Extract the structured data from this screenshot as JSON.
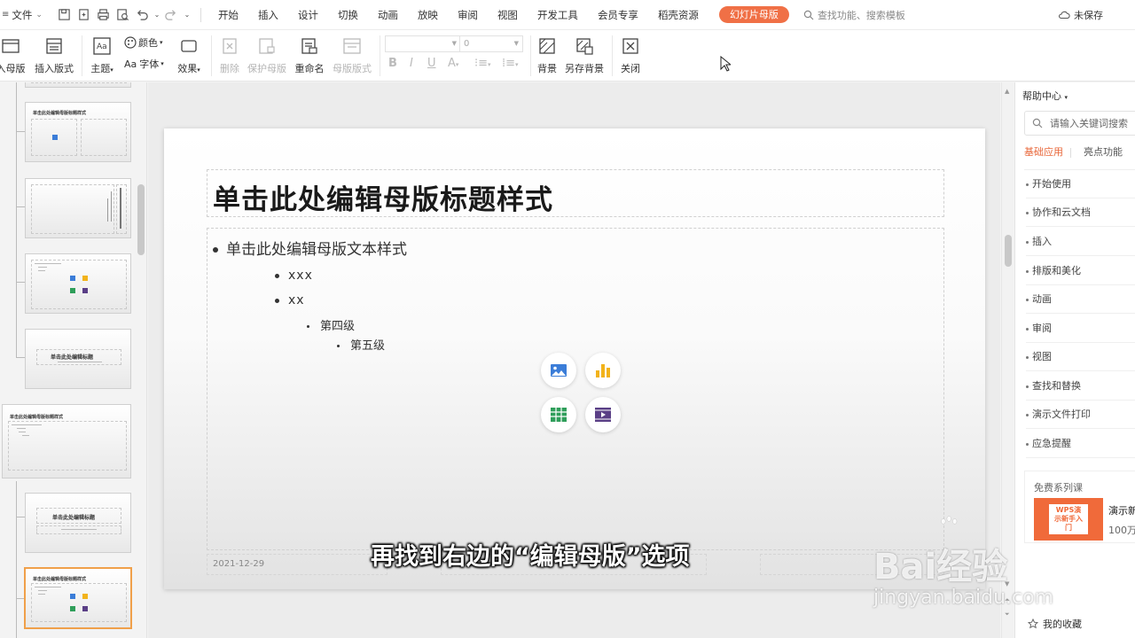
{
  "menubar": {
    "file_label": "文件",
    "tabs": [
      "开始",
      "插入",
      "设计",
      "切换",
      "动画",
      "放映",
      "审阅",
      "视图",
      "开发工具",
      "会员专享",
      "稻壳资源"
    ],
    "active_tab": "幻灯片母版",
    "search_label": "查找功能、搜索模板",
    "save_status": "未保存"
  },
  "ribbon": {
    "insert_master": "入母版",
    "insert_layout": "插入版式",
    "theme": "主题",
    "color": "颜色",
    "font": "字体",
    "font_prefix": "Aa",
    "effect": "效果",
    "delete": "删除",
    "protect_master": "保护母版",
    "rename": "重命名",
    "master_layout": "母版版式",
    "font_size_value": "0",
    "background": "背景",
    "save_background": "另存背景",
    "close": "关闭"
  },
  "thumbs": {
    "title_small": "单击此处编辑母版标题样式",
    "title_center": "单击此处编辑标题"
  },
  "slide": {
    "title": "单击此处编辑母版标题样式",
    "level1": "单击此处编辑母版文本样式",
    "level2": "xxx",
    "level3": "xx",
    "level4": "第四级",
    "level5": "第五级",
    "date": "2021-12-29"
  },
  "subtitle": "再找到右边的“编辑母版”选项",
  "watermark": {
    "brand": "Bai经验",
    "url": "jingyan.baidu.com"
  },
  "help": {
    "header": "帮助中心",
    "search_placeholder": "请输入关键词搜索",
    "tab_active": "基础应用",
    "tab_other": "亮点功能",
    "items": [
      "开始使用",
      "协作和云文档",
      "插入",
      "排版和美化",
      "动画",
      "审阅",
      "视图",
      "查找和替换",
      "演示文件打印",
      "应急提醒"
    ],
    "course_section": "免费系列课",
    "course_badge": "WPS演示新手入门",
    "course_name": "演示新",
    "course_count": "100万",
    "favorites": "我的收藏"
  },
  "colors": {
    "accent": "#f07046",
    "picture_icon": "#3b7dd8",
    "chart_icon": "#f2b31b",
    "table_icon": "#2f9e5a",
    "video_icon": "#5a3f86"
  }
}
